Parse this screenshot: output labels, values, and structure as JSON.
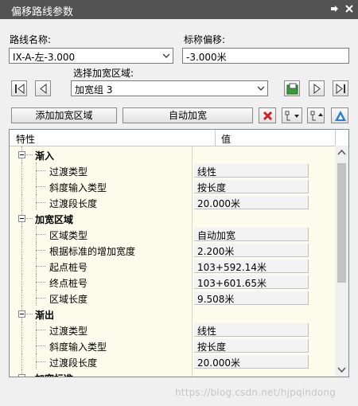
{
  "window": {
    "title": "偏移路线参数",
    "pin_icon": "pin-icon",
    "close_icon": "close-icon"
  },
  "route_name": {
    "label": "路线名称:",
    "value": "IX-A-左-3.000"
  },
  "offset": {
    "label": "标称偏移:",
    "value": "-3.000米"
  },
  "region_select": {
    "label": "选择加宽区域:",
    "value": "加宽组 3"
  },
  "toolbar": {
    "add_region": "添加加宽区域",
    "auto_widen": "自动加宽"
  },
  "grid": {
    "col_property": "特性",
    "col_value": "值",
    "rows": [
      {
        "key": "渐入",
        "value": "",
        "group": true
      },
      {
        "key": "过渡类型",
        "value": "线性"
      },
      {
        "key": "斜度输入类型",
        "value": "按长度"
      },
      {
        "key": "过渡段长度",
        "value": "20.000米"
      },
      {
        "key": "加宽区域",
        "value": "",
        "group": true
      },
      {
        "key": "区域类型",
        "value": "自动加宽"
      },
      {
        "key": "根据标准的增加宽度",
        "value": "2.200米"
      },
      {
        "key": "起点桩号",
        "value": "103+592.14米"
      },
      {
        "key": "终点桩号",
        "value": "103+601.65米"
      },
      {
        "key": "区域长度",
        "value": "9.508米"
      },
      {
        "key": "渐出",
        "value": "",
        "group": true
      },
      {
        "key": "过渡类型",
        "value": "线性"
      },
      {
        "key": "斜度输入类型",
        "value": "按长度"
      },
      {
        "key": "过渡段长度",
        "value": "20.000米"
      },
      {
        "key": "加宽标准",
        "value": "",
        "group": true
      }
    ]
  },
  "watermark": "https://blog.csdn.net/hjpqindong",
  "colors": {
    "titlebar": "#535353",
    "cell_bg": "#fdfcec",
    "delete_red": "#d62020"
  }
}
